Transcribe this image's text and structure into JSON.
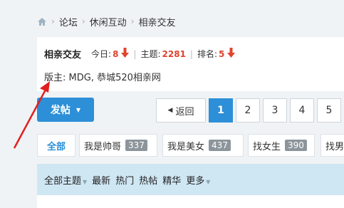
{
  "breadcrumb": {
    "icon": "home-icon",
    "items": [
      "论坛",
      "休闲互动",
      "相亲交友"
    ]
  },
  "forum": {
    "name": "相亲交友",
    "today_label": "今日:",
    "today_value": "8",
    "topics_label": "主题:",
    "topics_value": "2281",
    "rank_label": "排名:",
    "rank_value": "5",
    "moderators": "版主: MDG, 恭城520相亲网",
    "accent_color": "#e0442f"
  },
  "post_button": {
    "label": "发帖",
    "color": "#2c8fd8"
  },
  "pagination": {
    "back_label": "返回",
    "pages": [
      "1",
      "2",
      "3",
      "4",
      "5"
    ],
    "current": "1"
  },
  "categories": [
    {
      "label": "全部"
    },
    {
      "label": "我是帅哥",
      "count": "337"
    },
    {
      "label": "我是美女",
      "count": "437"
    },
    {
      "label": "找女生",
      "count": "390"
    },
    {
      "label": "找男"
    }
  ],
  "filters": {
    "all_topics": "全部主题",
    "items": [
      "最新",
      "热门",
      "热帖",
      "精华",
      "更多"
    ]
  }
}
